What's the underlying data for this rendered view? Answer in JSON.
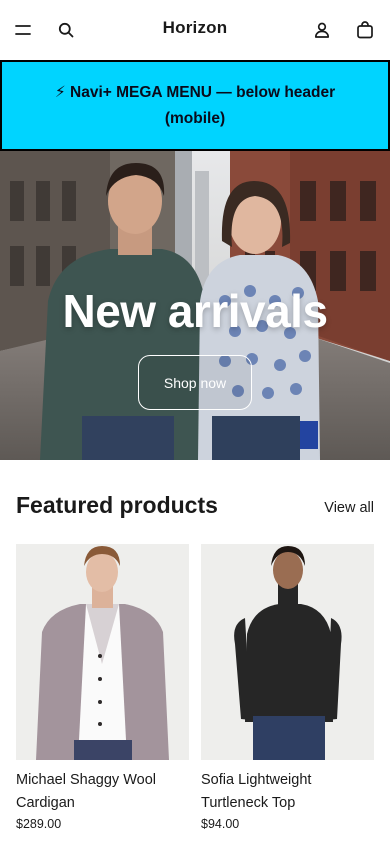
{
  "header": {
    "brand": "Horizon",
    "menu_icon": "hamburger-menu-icon",
    "search_icon": "search-icon",
    "account_icon": "user-icon",
    "cart_icon": "shopping-bag-icon"
  },
  "mega_menu": {
    "text": "⚡ Navi+ MEGA MENU — below header (mobile)",
    "bg_color": "#00d4ff"
  },
  "hero": {
    "title": "New arrivals",
    "button_label": "Shop now"
  },
  "featured": {
    "title": "Featured products",
    "view_all": "View all",
    "products": [
      {
        "name": "Michael Shaggy Wool Cardigan",
        "price": "$289.00"
      },
      {
        "name": "Sofia Lightweight Turtleneck Top",
        "price": "$94.00"
      }
    ]
  }
}
